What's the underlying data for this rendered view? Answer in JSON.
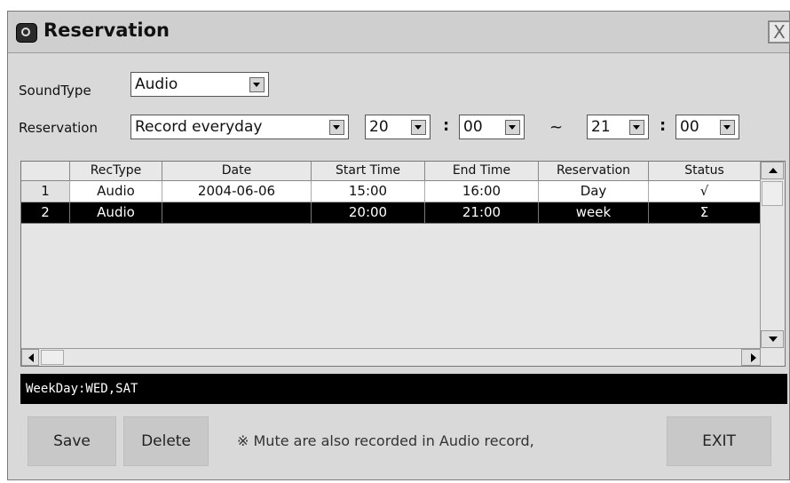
{
  "window": {
    "title": "Reservation",
    "close_label": "X"
  },
  "form": {
    "sound_type_label": "SoundType",
    "sound_type_value": "Audio",
    "reservation_label": "Reservation",
    "reservation_value": "Record everyday",
    "start_hour": "20",
    "start_minute": "00",
    "end_hour": "21",
    "end_minute": "00",
    "time_separator": ":",
    "range_separator": "~"
  },
  "table": {
    "columns": [
      "",
      "RecType",
      "Date",
      "Start Time",
      "End Time",
      "Reservation",
      "Status"
    ],
    "rows": [
      {
        "num": "1",
        "rectype": "Audio",
        "date": "2004-06-06",
        "start": "15:00",
        "end": "16:00",
        "reservation": "Day",
        "status": "√"
      },
      {
        "num": "2",
        "rectype": "Audio",
        "date": "",
        "start": "20:00",
        "end": "21:00",
        "reservation": "week",
        "status": "Σ"
      }
    ],
    "selected_row": 2
  },
  "status_bar": {
    "text": "WeekDay:WED,SAT"
  },
  "footer": {
    "save_label": "Save",
    "delete_label": "Delete",
    "note": "※ Mute are also recorded in Audio record,",
    "exit_label": "EXIT"
  }
}
